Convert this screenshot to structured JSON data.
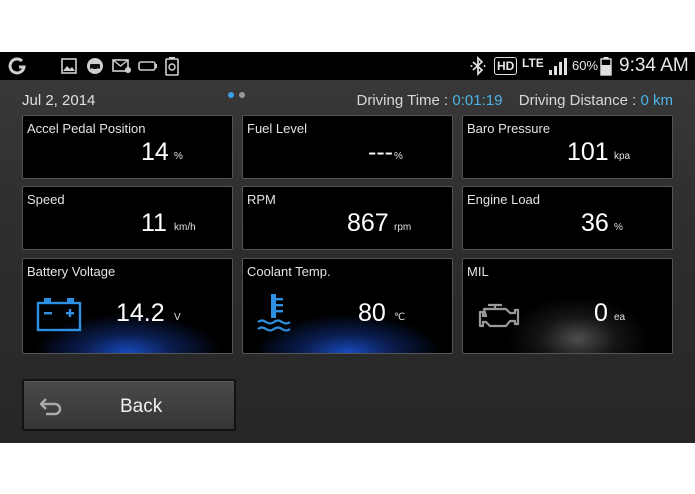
{
  "status_bar": {
    "left_icons": [
      "app-g-icon",
      "image-icon",
      "car-icon",
      "email-icon",
      "battery-outline-icon",
      "recycle-battery-icon"
    ],
    "right_icons": [
      "bluetooth-icon",
      "hd-icon",
      "lte-icon",
      "signal-icon",
      "battery-icon"
    ],
    "hd": "HD",
    "lte": "LTE",
    "battery_percent": "60%",
    "time": "9:34 AM"
  },
  "header": {
    "date": "Jul 2, 2014",
    "driving_time_label": "Driving Time : ",
    "driving_time_value": "0:01:19",
    "driving_distance_label": "Driving Distance : ",
    "driving_distance_value": "0 km",
    "pager": {
      "pages": 2,
      "active": 1
    }
  },
  "tiles": {
    "accel": {
      "label": "Accel Pedal Position",
      "value": "14",
      "unit": "%"
    },
    "fuel": {
      "label": "Fuel Level",
      "value": "---",
      "unit": "%"
    },
    "baro": {
      "label": "Baro Pressure",
      "value": "101",
      "unit": "kpa"
    },
    "speed": {
      "label": "Speed",
      "value": "11",
      "unit": "km/h"
    },
    "rpm": {
      "label": "RPM",
      "value": "867",
      "unit": "rpm"
    },
    "load": {
      "label": "Engine Load",
      "value": "36",
      "unit": "%"
    },
    "battery": {
      "label": "Battery Voltage",
      "value": "14.2",
      "unit": "V",
      "icon": "car-battery-icon"
    },
    "coolant": {
      "label": "Coolant Temp.",
      "value": "80",
      "unit": "℃",
      "icon": "coolant-temperature-icon"
    },
    "mil": {
      "label": "MIL",
      "value": "0",
      "unit": "ea",
      "icon": "check-engine-icon"
    }
  },
  "back_button": {
    "label": "Back",
    "icon": "back-arrow-icon"
  },
  "colors": {
    "accent": "#4fb3e8",
    "icon_blue": "#2f8fe0",
    "glow_blue": "#1a4fc8",
    "pager_active": "#3ba0e6",
    "pager_inactive": "#9a9a9a"
  }
}
